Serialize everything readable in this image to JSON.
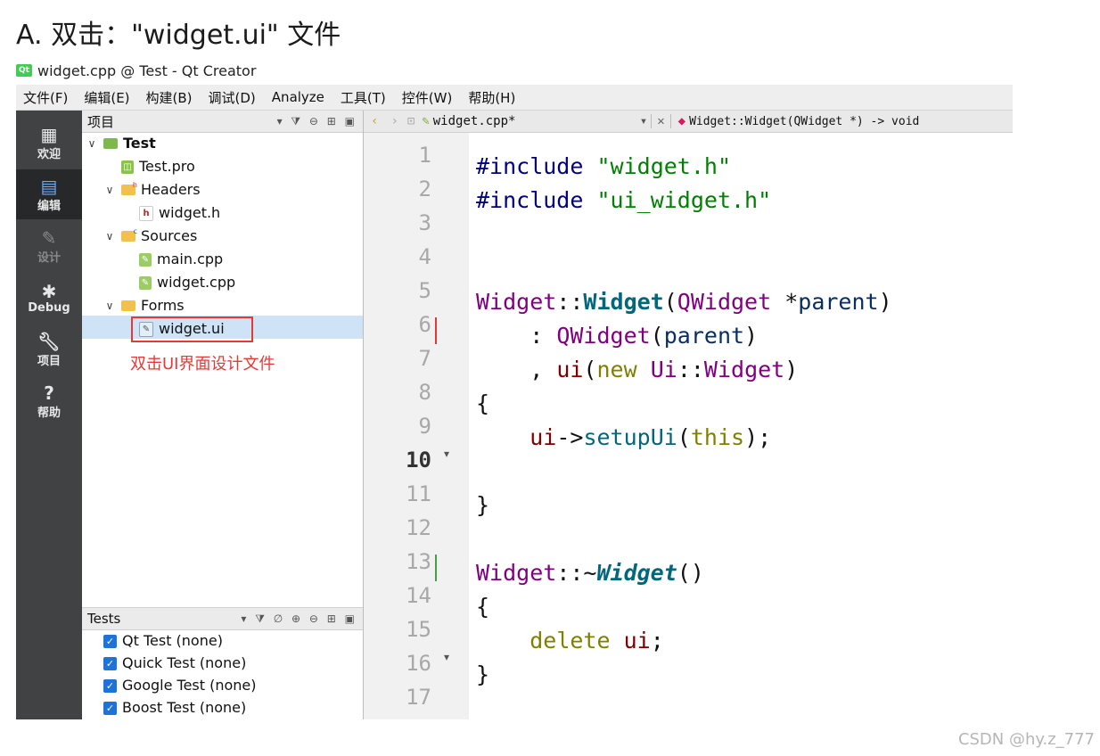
{
  "heading": "A. 双击：\"widget.ui\" 文件",
  "window_title": "widget.cpp @ Test - Qt Creator",
  "menu": [
    "文件(F)",
    "编辑(E)",
    "构建(B)",
    "调试(D)",
    "Analyze",
    "工具(T)",
    "控件(W)",
    "帮助(H)"
  ],
  "modes": [
    {
      "label": "欢迎",
      "icon": "grid-icon"
    },
    {
      "label": "编辑",
      "icon": "edit-doc-icon"
    },
    {
      "label": "设计",
      "icon": "pencil-icon"
    },
    {
      "label": "Debug",
      "icon": "bug-icon"
    },
    {
      "label": "项目",
      "icon": "wrench-icon"
    },
    {
      "label": "帮助",
      "icon": "help-icon"
    }
  ],
  "project_pane": {
    "title": "项目",
    "tree": [
      {
        "label": "Test",
        "depth": 0,
        "kind": "project",
        "expanded": true
      },
      {
        "label": "Test.pro",
        "depth": 1,
        "kind": "pro-file"
      },
      {
        "label": "Headers",
        "depth": 1,
        "kind": "folder",
        "expanded": true
      },
      {
        "label": "widget.h",
        "depth": 2,
        "kind": "header-file"
      },
      {
        "label": "Sources",
        "depth": 1,
        "kind": "folder",
        "expanded": true
      },
      {
        "label": "main.cpp",
        "depth": 2,
        "kind": "cpp-file"
      },
      {
        "label": "widget.cpp",
        "depth": 2,
        "kind": "cpp-file"
      },
      {
        "label": "Forms",
        "depth": 1,
        "kind": "folder",
        "expanded": true
      },
      {
        "label": "widget.ui",
        "depth": 2,
        "kind": "ui-file",
        "selected": true
      }
    ],
    "annotation": "双击UI界面设计文件"
  },
  "tests_pane": {
    "title": "Tests",
    "items": [
      "Qt Test (none)",
      "Quick Test (none)",
      "Google Test (none)",
      "Boost Test (none)"
    ]
  },
  "editor": {
    "file_tab": "widget.cpp*",
    "symbol": "Widget::Widget(QWidget *) -> void",
    "current_line": 10,
    "line_numbers": [
      "1",
      "2",
      "3",
      "4",
      "5",
      "6",
      "7",
      "8",
      "9",
      "10",
      "11",
      "12",
      "13",
      "14",
      "15",
      "16",
      "17"
    ]
  },
  "watermark": "CSDN @hy.z_777"
}
